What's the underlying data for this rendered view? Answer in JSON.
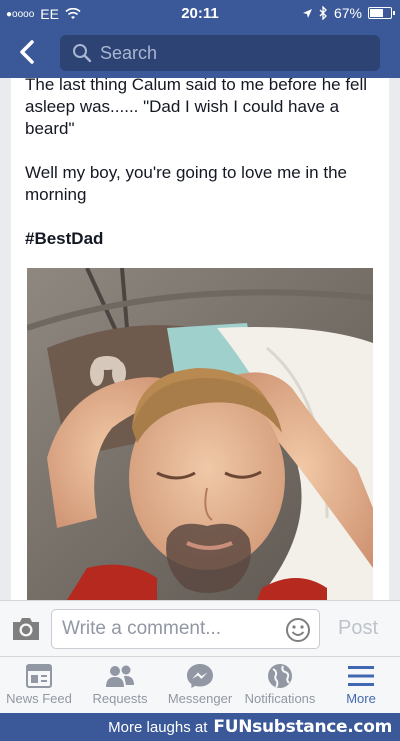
{
  "status_bar": {
    "signal_dots": "●oooo",
    "carrier": "EE",
    "wifi_icon": "wifi-icon",
    "time": "20:11",
    "location_icon": "location-arrow-icon",
    "bluetooth_icon": "bluetooth-icon",
    "battery_percent": "67%",
    "battery_level": 0.67
  },
  "navbar": {
    "back_icon": "chevron-left-icon",
    "search_placeholder": "Search",
    "search_icon": "search-icon"
  },
  "post": {
    "line1": "The last thing Calum said to me before he fell asleep was...... \"Dad I wish I could have a beard\"",
    "line2": "Well my boy, you're going to love me in the morning",
    "hashtag": "#BestDad"
  },
  "comment_bar": {
    "camera_icon": "camera-icon",
    "placeholder": "Write a comment...",
    "emoji_icon": "smiley-icon",
    "post_label": "Post"
  },
  "tabs": [
    {
      "label": "News Feed",
      "icon": "news-feed-icon"
    },
    {
      "label": "Requests",
      "icon": "friend-requests-icon"
    },
    {
      "label": "Messenger",
      "icon": "messenger-icon"
    },
    {
      "label": "Notifications",
      "icon": "globe-icon"
    },
    {
      "label": "More",
      "icon": "hamburger-menu-icon"
    }
  ],
  "banner": {
    "text": "More laughs at",
    "logo": "FUNsubstance.com"
  },
  "colors": {
    "brand": "#3b5998",
    "active_tab": "#4267b2",
    "inactive": "#9197a3"
  }
}
